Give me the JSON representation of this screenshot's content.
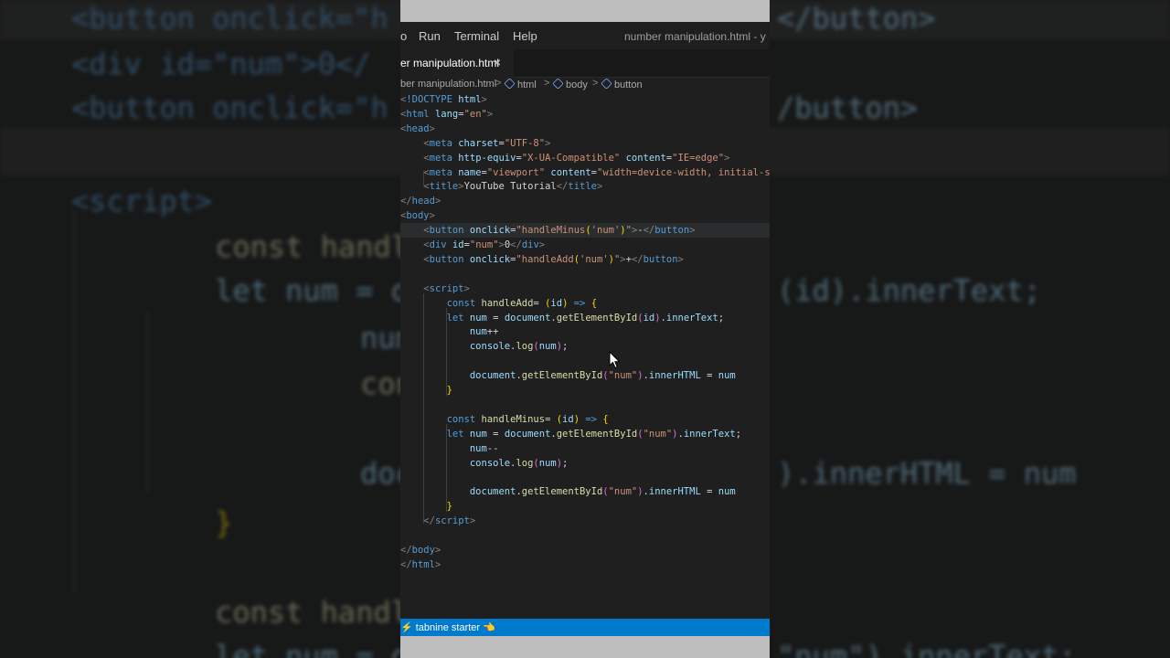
{
  "background": {
    "lines": [
      "<button onclick=\"h",
      "<div id=\"num\">0</",
      "<button onclick=\"h",
      "<script>",
      "    const handleAd",
      "    let num = docu",
      "        num++",
      "        console.lo",
      "        document.g",
      "    }",
      "    const handleMi",
      "    let num = docu"
    ],
    "right_lines": [
      "</button>",
      "/button>",
      "(id).innerText;",
      ").innerHTML = num",
      "\"num\").innerText;"
    ]
  },
  "menu": {
    "partial_item": "o",
    "items": [
      "Run",
      "Terminal",
      "Help"
    ],
    "window_title": "number manipulation.html - y"
  },
  "tab": {
    "label": "er manipulation.html",
    "close_glyph": "×"
  },
  "breadcrumb": {
    "file": "ber manipulation.html",
    "items": [
      "html",
      "body",
      "button"
    ],
    "separator": ">"
  },
  "code_lines": [
    [
      [
        "t-br",
        "<"
      ],
      [
        "t-tag",
        "!DOCTYPE "
      ],
      [
        "t-attr",
        "html"
      ],
      [
        "t-br",
        ">"
      ]
    ],
    [
      [
        "t-br",
        "<"
      ],
      [
        "t-tag",
        "html "
      ],
      [
        "t-attr",
        "lang"
      ],
      [
        "t-txt",
        "="
      ],
      [
        "t-str",
        "\"en\""
      ],
      [
        "t-br",
        ">"
      ]
    ],
    [
      [
        "t-br",
        "<"
      ],
      [
        "t-tag",
        "head"
      ],
      [
        "t-br",
        ">"
      ]
    ],
    [
      [
        "t-txt",
        "    "
      ],
      [
        "t-br",
        "<"
      ],
      [
        "t-tag",
        "meta "
      ],
      [
        "t-attr",
        "charset"
      ],
      [
        "t-txt",
        "="
      ],
      [
        "t-str",
        "\"UTF-8\""
      ],
      [
        "t-br",
        ">"
      ]
    ],
    [
      [
        "t-txt",
        "    "
      ],
      [
        "t-br",
        "<"
      ],
      [
        "t-tag",
        "meta "
      ],
      [
        "t-attr",
        "http-equiv"
      ],
      [
        "t-txt",
        "="
      ],
      [
        "t-str",
        "\"X-UA-Compatible\""
      ],
      [
        "t-txt",
        " "
      ],
      [
        "t-attr",
        "content"
      ],
      [
        "t-txt",
        "="
      ],
      [
        "t-str",
        "\"IE=edge\""
      ],
      [
        "t-br",
        ">"
      ]
    ],
    [
      [
        "t-txt",
        "    "
      ],
      [
        "t-br",
        "<"
      ],
      [
        "t-tag",
        "meta "
      ],
      [
        "t-attr",
        "name"
      ],
      [
        "t-txt",
        "="
      ],
      [
        "t-str",
        "\"viewport\""
      ],
      [
        "t-txt",
        " "
      ],
      [
        "t-attr",
        "content"
      ],
      [
        "t-txt",
        "="
      ],
      [
        "t-str",
        "\"width=device-width, initial-s"
      ]
    ],
    [
      [
        "t-txt",
        "    "
      ],
      [
        "t-br",
        "<"
      ],
      [
        "t-tag",
        "title"
      ],
      [
        "t-br",
        ">"
      ],
      [
        "t-txt",
        "YouTube Tutorial"
      ],
      [
        "t-br",
        "</"
      ],
      [
        "t-tag",
        "title"
      ],
      [
        "t-br",
        ">"
      ]
    ],
    [
      [
        "t-br",
        "</"
      ],
      [
        "t-tag",
        "head"
      ],
      [
        "t-br",
        ">"
      ]
    ],
    [
      [
        "t-br",
        "<"
      ],
      [
        "t-tag",
        "body"
      ],
      [
        "t-br",
        ">"
      ]
    ],
    [
      [
        "t-txt",
        "    "
      ],
      [
        "t-br",
        "<"
      ],
      [
        "t-tag",
        "button "
      ],
      [
        "t-attr",
        "onclick"
      ],
      [
        "t-txt",
        "="
      ],
      [
        "t-str",
        "\"handleMinus"
      ],
      [
        "t-br1",
        "("
      ],
      [
        "t-str",
        "'num'"
      ],
      [
        "t-br1",
        ")"
      ],
      [
        "t-str",
        "\""
      ],
      [
        "t-br",
        ">"
      ],
      [
        "t-txt",
        "-"
      ],
      [
        "t-br",
        "</"
      ],
      [
        "t-tag",
        "button"
      ],
      [
        "t-br",
        ">"
      ]
    ],
    [
      [
        "t-txt",
        "    "
      ],
      [
        "t-br",
        "<"
      ],
      [
        "t-tag",
        "div "
      ],
      [
        "t-attr",
        "id"
      ],
      [
        "t-txt",
        "="
      ],
      [
        "t-str",
        "\"num\""
      ],
      [
        "t-br",
        ">"
      ],
      [
        "t-txt",
        "0"
      ],
      [
        "t-br",
        "</"
      ],
      [
        "t-tag",
        "div"
      ],
      [
        "t-br",
        ">"
      ]
    ],
    [
      [
        "t-txt",
        "    "
      ],
      [
        "t-br",
        "<"
      ],
      [
        "t-tag",
        "button "
      ],
      [
        "t-attr",
        "onclick"
      ],
      [
        "t-txt",
        "="
      ],
      [
        "t-str",
        "\"handleAdd"
      ],
      [
        "t-br1",
        "("
      ],
      [
        "t-str",
        "'num'"
      ],
      [
        "t-br1",
        ")"
      ],
      [
        "t-str",
        "\""
      ],
      [
        "t-br",
        ">"
      ],
      [
        "t-txt",
        "+"
      ],
      [
        "t-br",
        "</"
      ],
      [
        "t-tag",
        "button"
      ],
      [
        "t-br",
        ">"
      ]
    ],
    [],
    [
      [
        "t-txt",
        "    "
      ],
      [
        "t-br",
        "<"
      ],
      [
        "t-tag",
        "script"
      ],
      [
        "t-br",
        ">"
      ]
    ],
    [
      [
        "t-txt",
        "        "
      ],
      [
        "t-kw",
        "const "
      ],
      [
        "t-fn",
        "handleAdd"
      ],
      [
        "t-txt",
        "= "
      ],
      [
        "t-br1",
        "("
      ],
      [
        "t-var",
        "id"
      ],
      [
        "t-br1",
        ")"
      ],
      [
        "t-txt",
        " "
      ],
      [
        "t-kw",
        "=>"
      ],
      [
        "t-txt",
        " "
      ],
      [
        "t-br1",
        "{"
      ]
    ],
    [
      [
        "t-txt",
        "        "
      ],
      [
        "t-kw",
        "let "
      ],
      [
        "t-var",
        "num"
      ],
      [
        "t-txt",
        " = "
      ],
      [
        "t-var",
        "document"
      ],
      [
        "t-txt",
        "."
      ],
      [
        "t-fn",
        "getElementById"
      ],
      [
        "t-br2",
        "("
      ],
      [
        "t-var",
        "id"
      ],
      [
        "t-br2",
        ")"
      ],
      [
        "t-txt",
        "."
      ],
      [
        "t-var",
        "innerText"
      ],
      [
        "t-txt",
        ";"
      ]
    ],
    [
      [
        "t-txt",
        "            "
      ],
      [
        "t-var",
        "num"
      ],
      [
        "t-txt",
        "++"
      ]
    ],
    [
      [
        "t-txt",
        "            "
      ],
      [
        "t-var",
        "console"
      ],
      [
        "t-txt",
        "."
      ],
      [
        "t-fn",
        "log"
      ],
      [
        "t-br2",
        "("
      ],
      [
        "t-var",
        "num"
      ],
      [
        "t-br2",
        ")"
      ],
      [
        "t-txt",
        ";"
      ]
    ],
    [],
    [
      [
        "t-txt",
        "            "
      ],
      [
        "t-var",
        "document"
      ],
      [
        "t-txt",
        "."
      ],
      [
        "t-fn",
        "getElementById"
      ],
      [
        "t-br2",
        "("
      ],
      [
        "t-str",
        "\"num\""
      ],
      [
        "t-br2",
        ")"
      ],
      [
        "t-txt",
        "."
      ],
      [
        "t-var",
        "innerHTML"
      ],
      [
        "t-txt",
        " = "
      ],
      [
        "t-var",
        "num"
      ]
    ],
    [
      [
        "t-txt",
        "        "
      ],
      [
        "t-br1",
        "}"
      ]
    ],
    [],
    [
      [
        "t-txt",
        "        "
      ],
      [
        "t-kw",
        "const "
      ],
      [
        "t-fn",
        "handleMinus"
      ],
      [
        "t-txt",
        "= "
      ],
      [
        "t-br1",
        "("
      ],
      [
        "t-var",
        "id"
      ],
      [
        "t-br1",
        ")"
      ],
      [
        "t-txt",
        " "
      ],
      [
        "t-kw",
        "=>"
      ],
      [
        "t-txt",
        " "
      ],
      [
        "t-br1",
        "{"
      ]
    ],
    [
      [
        "t-txt",
        "        "
      ],
      [
        "t-kw",
        "let "
      ],
      [
        "t-var",
        "num"
      ],
      [
        "t-txt",
        " = "
      ],
      [
        "t-var",
        "document"
      ],
      [
        "t-txt",
        "."
      ],
      [
        "t-fn",
        "getElementById"
      ],
      [
        "t-br2",
        "("
      ],
      [
        "t-str",
        "\"num\""
      ],
      [
        "t-br2",
        ")"
      ],
      [
        "t-txt",
        "."
      ],
      [
        "t-var",
        "innerText"
      ],
      [
        "t-txt",
        ";"
      ]
    ],
    [
      [
        "t-txt",
        "            "
      ],
      [
        "t-var",
        "num"
      ],
      [
        "t-txt",
        "--"
      ]
    ],
    [
      [
        "t-txt",
        "            "
      ],
      [
        "t-var",
        "console"
      ],
      [
        "t-txt",
        "."
      ],
      [
        "t-fn",
        "log"
      ],
      [
        "t-br2",
        "("
      ],
      [
        "t-var",
        "num"
      ],
      [
        "t-br2",
        ")"
      ],
      [
        "t-txt",
        ";"
      ]
    ],
    [],
    [
      [
        "t-txt",
        "            "
      ],
      [
        "t-var",
        "document"
      ],
      [
        "t-txt",
        "."
      ],
      [
        "t-fn",
        "getElementById"
      ],
      [
        "t-br2",
        "("
      ],
      [
        "t-str",
        "\"num\""
      ],
      [
        "t-br2",
        ")"
      ],
      [
        "t-txt",
        "."
      ],
      [
        "t-var",
        "innerHTML"
      ],
      [
        "t-txt",
        " = "
      ],
      [
        "t-var",
        "num"
      ]
    ],
    [
      [
        "t-txt",
        "        "
      ],
      [
        "t-br1",
        "}"
      ]
    ],
    [
      [
        "t-txt",
        "    "
      ],
      [
        "t-br",
        "</"
      ],
      [
        "t-tag",
        "script"
      ],
      [
        "t-br",
        ">"
      ]
    ],
    [],
    [
      [
        "t-br",
        "</"
      ],
      [
        "t-tag",
        "body"
      ],
      [
        "t-br",
        ">"
      ]
    ],
    [
      [
        "t-br",
        "</"
      ],
      [
        "t-tag",
        "html"
      ],
      [
        "t-br",
        ">"
      ]
    ]
  ],
  "highlighted_line": 9,
  "statusbar": {
    "text": "⚡ tabnine starter 👈"
  },
  "colors": {
    "accent": "#007acc",
    "editor_bg": "#1f1f1f",
    "line_highlight": "#2a2d2e"
  }
}
